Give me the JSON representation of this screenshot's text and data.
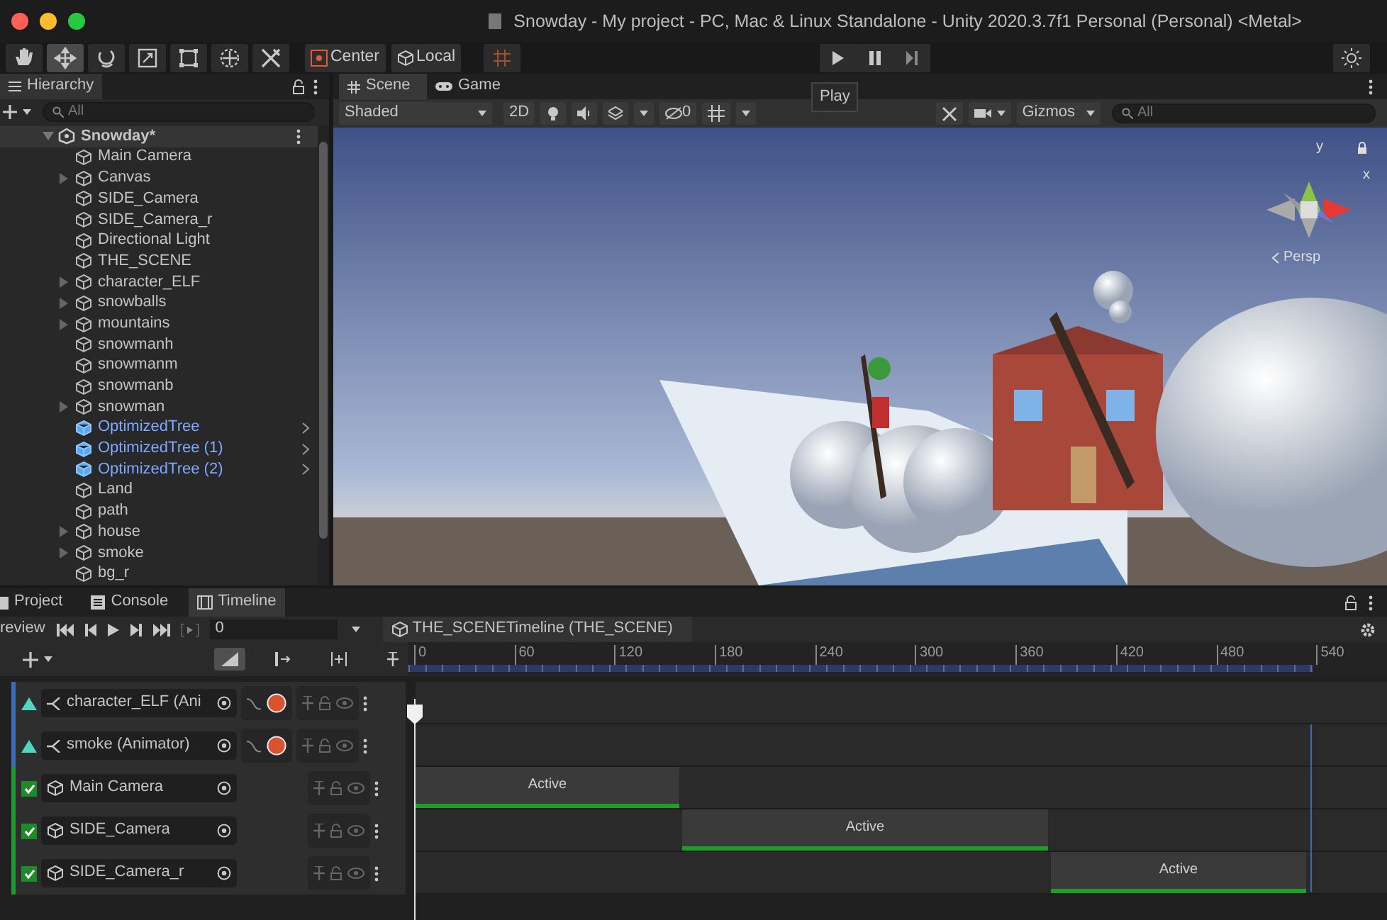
{
  "window": {
    "title": "Snowday - My project - PC, Mac & Linux Standalone - Unity 2020.3.7f1 Personal (Personal) <Metal>"
  },
  "toolbar": {
    "tools": [
      {
        "kind": "hand",
        "selected": false
      },
      {
        "kind": "move",
        "selected": true
      },
      {
        "kind": "rotate",
        "selected": false
      },
      {
        "kind": "scale",
        "selected": false
      },
      {
        "kind": "rect",
        "selected": false
      },
      {
        "kind": "transform",
        "selected": false
      },
      {
        "kind": "custom",
        "selected": false
      }
    ],
    "pivot": "Center",
    "handle": "Local",
    "tooltip": "Play"
  },
  "hierarchy": {
    "title": "Hierarchy",
    "search": {
      "placeholder": "All"
    },
    "root": {
      "name": "Snowday*",
      "expanded": true,
      "children": [
        {
          "name": "Main Camera",
          "kind": "object",
          "has_children": false
        },
        {
          "name": "Canvas",
          "kind": "object",
          "has_children": true
        },
        {
          "name": "SIDE_Camera",
          "kind": "object",
          "has_children": false
        },
        {
          "name": "SIDE_Camera_r",
          "kind": "object",
          "has_children": false
        },
        {
          "name": "Directional Light",
          "kind": "object",
          "has_children": false
        },
        {
          "name": "THE_SCENE",
          "kind": "object",
          "has_children": false
        },
        {
          "name": "character_ELF",
          "kind": "object",
          "has_children": true
        },
        {
          "name": "snowballs",
          "kind": "object",
          "has_children": true
        },
        {
          "name": "mountains",
          "kind": "object",
          "has_children": true
        },
        {
          "name": "snowmanh",
          "kind": "object",
          "has_children": false
        },
        {
          "name": "snowmanm",
          "kind": "object",
          "has_children": false
        },
        {
          "name": "snowmanb",
          "kind": "object",
          "has_children": false
        },
        {
          "name": "snowman",
          "kind": "object",
          "has_children": true
        },
        {
          "name": "OptimizedTree",
          "kind": "prefab",
          "has_children": false
        },
        {
          "name": "OptimizedTree (1)",
          "kind": "prefab",
          "has_children": false
        },
        {
          "name": "OptimizedTree (2)",
          "kind": "prefab",
          "has_children": false
        },
        {
          "name": "Land",
          "kind": "object",
          "has_children": false
        },
        {
          "name": "path",
          "kind": "object",
          "has_children": false
        },
        {
          "name": "house",
          "kind": "object",
          "has_children": true
        },
        {
          "name": "smoke",
          "kind": "object",
          "has_children": true
        },
        {
          "name": "bg_r",
          "kind": "object",
          "has_children": false
        }
      ]
    }
  },
  "scene_tabs": [
    {
      "label": "Scene",
      "kind": "scene",
      "selected": true
    },
    {
      "label": "Game",
      "kind": "game",
      "selected": false
    }
  ],
  "scene_toolbar": {
    "shading": "Shaded",
    "mode_2d": "2D",
    "hidden_count": "0",
    "gizmos": "Gizmos",
    "search": {
      "placeholder": "All"
    }
  },
  "scene_view": {
    "axis_labels": [
      "y",
      "x"
    ],
    "projection": "Persp"
  },
  "bottom_tabs": [
    {
      "label": "Project",
      "kind": "project",
      "selected": false
    },
    {
      "label": "Console",
      "kind": "console",
      "selected": false
    },
    {
      "label": "Timeline",
      "kind": "timeline",
      "selected": true
    }
  ],
  "timeline": {
    "preview": "review",
    "frame": "0",
    "breadcrumb": "THE_SCENETimeline (THE_SCENE)",
    "ruler": [
      "0",
      "60",
      "120",
      "180",
      "240",
      "300",
      "360",
      "420",
      "480",
      "540"
    ],
    "tracks": [
      {
        "kind": "animation",
        "name": "character_ELF (Ani"
      },
      {
        "kind": "animation",
        "name": "smoke (Animator)"
      },
      {
        "kind": "activation",
        "name": "Main Camera",
        "checked": true,
        "clip": "Active"
      },
      {
        "kind": "activation",
        "name": "SIDE_Camera",
        "checked": true,
        "clip": "Active"
      },
      {
        "kind": "activation",
        "name": "SIDE_Camera_r",
        "checked": true,
        "clip": "Active"
      }
    ]
  }
}
